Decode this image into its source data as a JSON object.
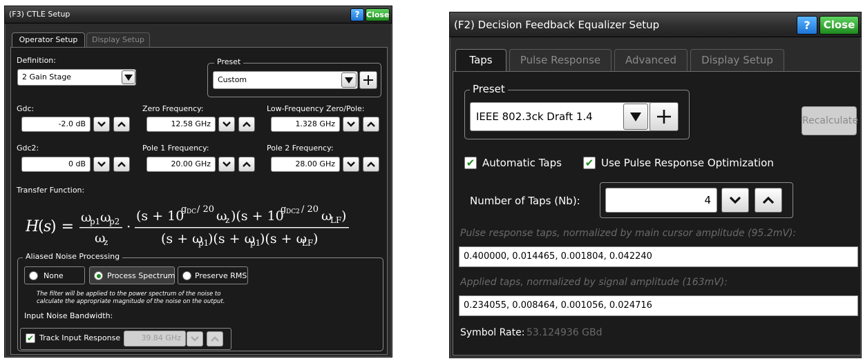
{
  "ctle": {
    "title": "(F3) CTLE Setup",
    "help_label": "?",
    "close_label": "Close",
    "tabs": [
      {
        "label": "Operator Setup",
        "active": true
      },
      {
        "label": "Display Setup",
        "active": false
      }
    ],
    "definition": {
      "label": "Definition:",
      "value": "2 Gain Stage"
    },
    "preset": {
      "label": "Preset",
      "value": "Custom"
    },
    "params": {
      "gdc": {
        "label": "Gdc:",
        "value": "-2.0 dB"
      },
      "zero_freq": {
        "label": "Zero Frequency:",
        "value": "12.58 GHz"
      },
      "lf_zero_pole": {
        "label": "Low-Frequency Zero/Pole:",
        "value": "1.328 GHz"
      },
      "gdc2": {
        "label": "Gdc2:",
        "value": "0 dB"
      },
      "pole1": {
        "label": "Pole 1 Frequency:",
        "value": "20.00 GHz"
      },
      "pole2": {
        "label": "Pole 2 Frequency:",
        "value": "28.00 GHz"
      }
    },
    "transfer_function_label": "Transfer Function:",
    "aliased_noise": {
      "legend": "Aliased Noise Processing",
      "options": [
        {
          "label": "None",
          "selected": false
        },
        {
          "label": "Process Spectrum",
          "selected": true
        },
        {
          "label": "Preserve RMS",
          "selected": false
        }
      ],
      "note_line1": "The filter will be applied to the power spectrum of the noise to",
      "note_line2": "calculate the appropriate magnitude of the noise on the output.",
      "bandwidth_label": "Input Noise Bandwidth:",
      "track_label": "Track Input Response",
      "track_checked": true,
      "bandwidth_value": "39.84 GHz"
    }
  },
  "dfe": {
    "title": "(F2) Decision Feedback Equalizer Setup",
    "help_label": "?",
    "close_label": "Close",
    "tabs": [
      {
        "label": "Taps",
        "active": true
      },
      {
        "label": "Pulse Response",
        "active": false
      },
      {
        "label": "Advanced",
        "active": false
      },
      {
        "label": "Display Setup",
        "active": false
      }
    ],
    "preset": {
      "label": "Preset",
      "value": "IEEE 802.3ck Draft 1.4"
    },
    "recalculate_label": "Recalculate",
    "automatic_taps": {
      "label": "Automatic Taps",
      "checked": true
    },
    "pulse_opt": {
      "label": "Use Pulse Response Optimization",
      "checked": true
    },
    "num_taps": {
      "label": "Number of Taps (Nb):",
      "value": "4"
    },
    "pulse_taps_hint": "Pulse response taps, normalized by main cursor amplitude (95.2mV):",
    "pulse_taps_value": "0.400000, 0.014465, 0.001804, 0.042240",
    "applied_taps_hint": "Applied taps, normalized by signal amplitude (163mV):",
    "applied_taps_value": "0.234055, 0.008464, 0.001056, 0.024716",
    "symbol_rate_label": "Symbol Rate:",
    "symbol_rate_value": "53.124936 GBd"
  }
}
